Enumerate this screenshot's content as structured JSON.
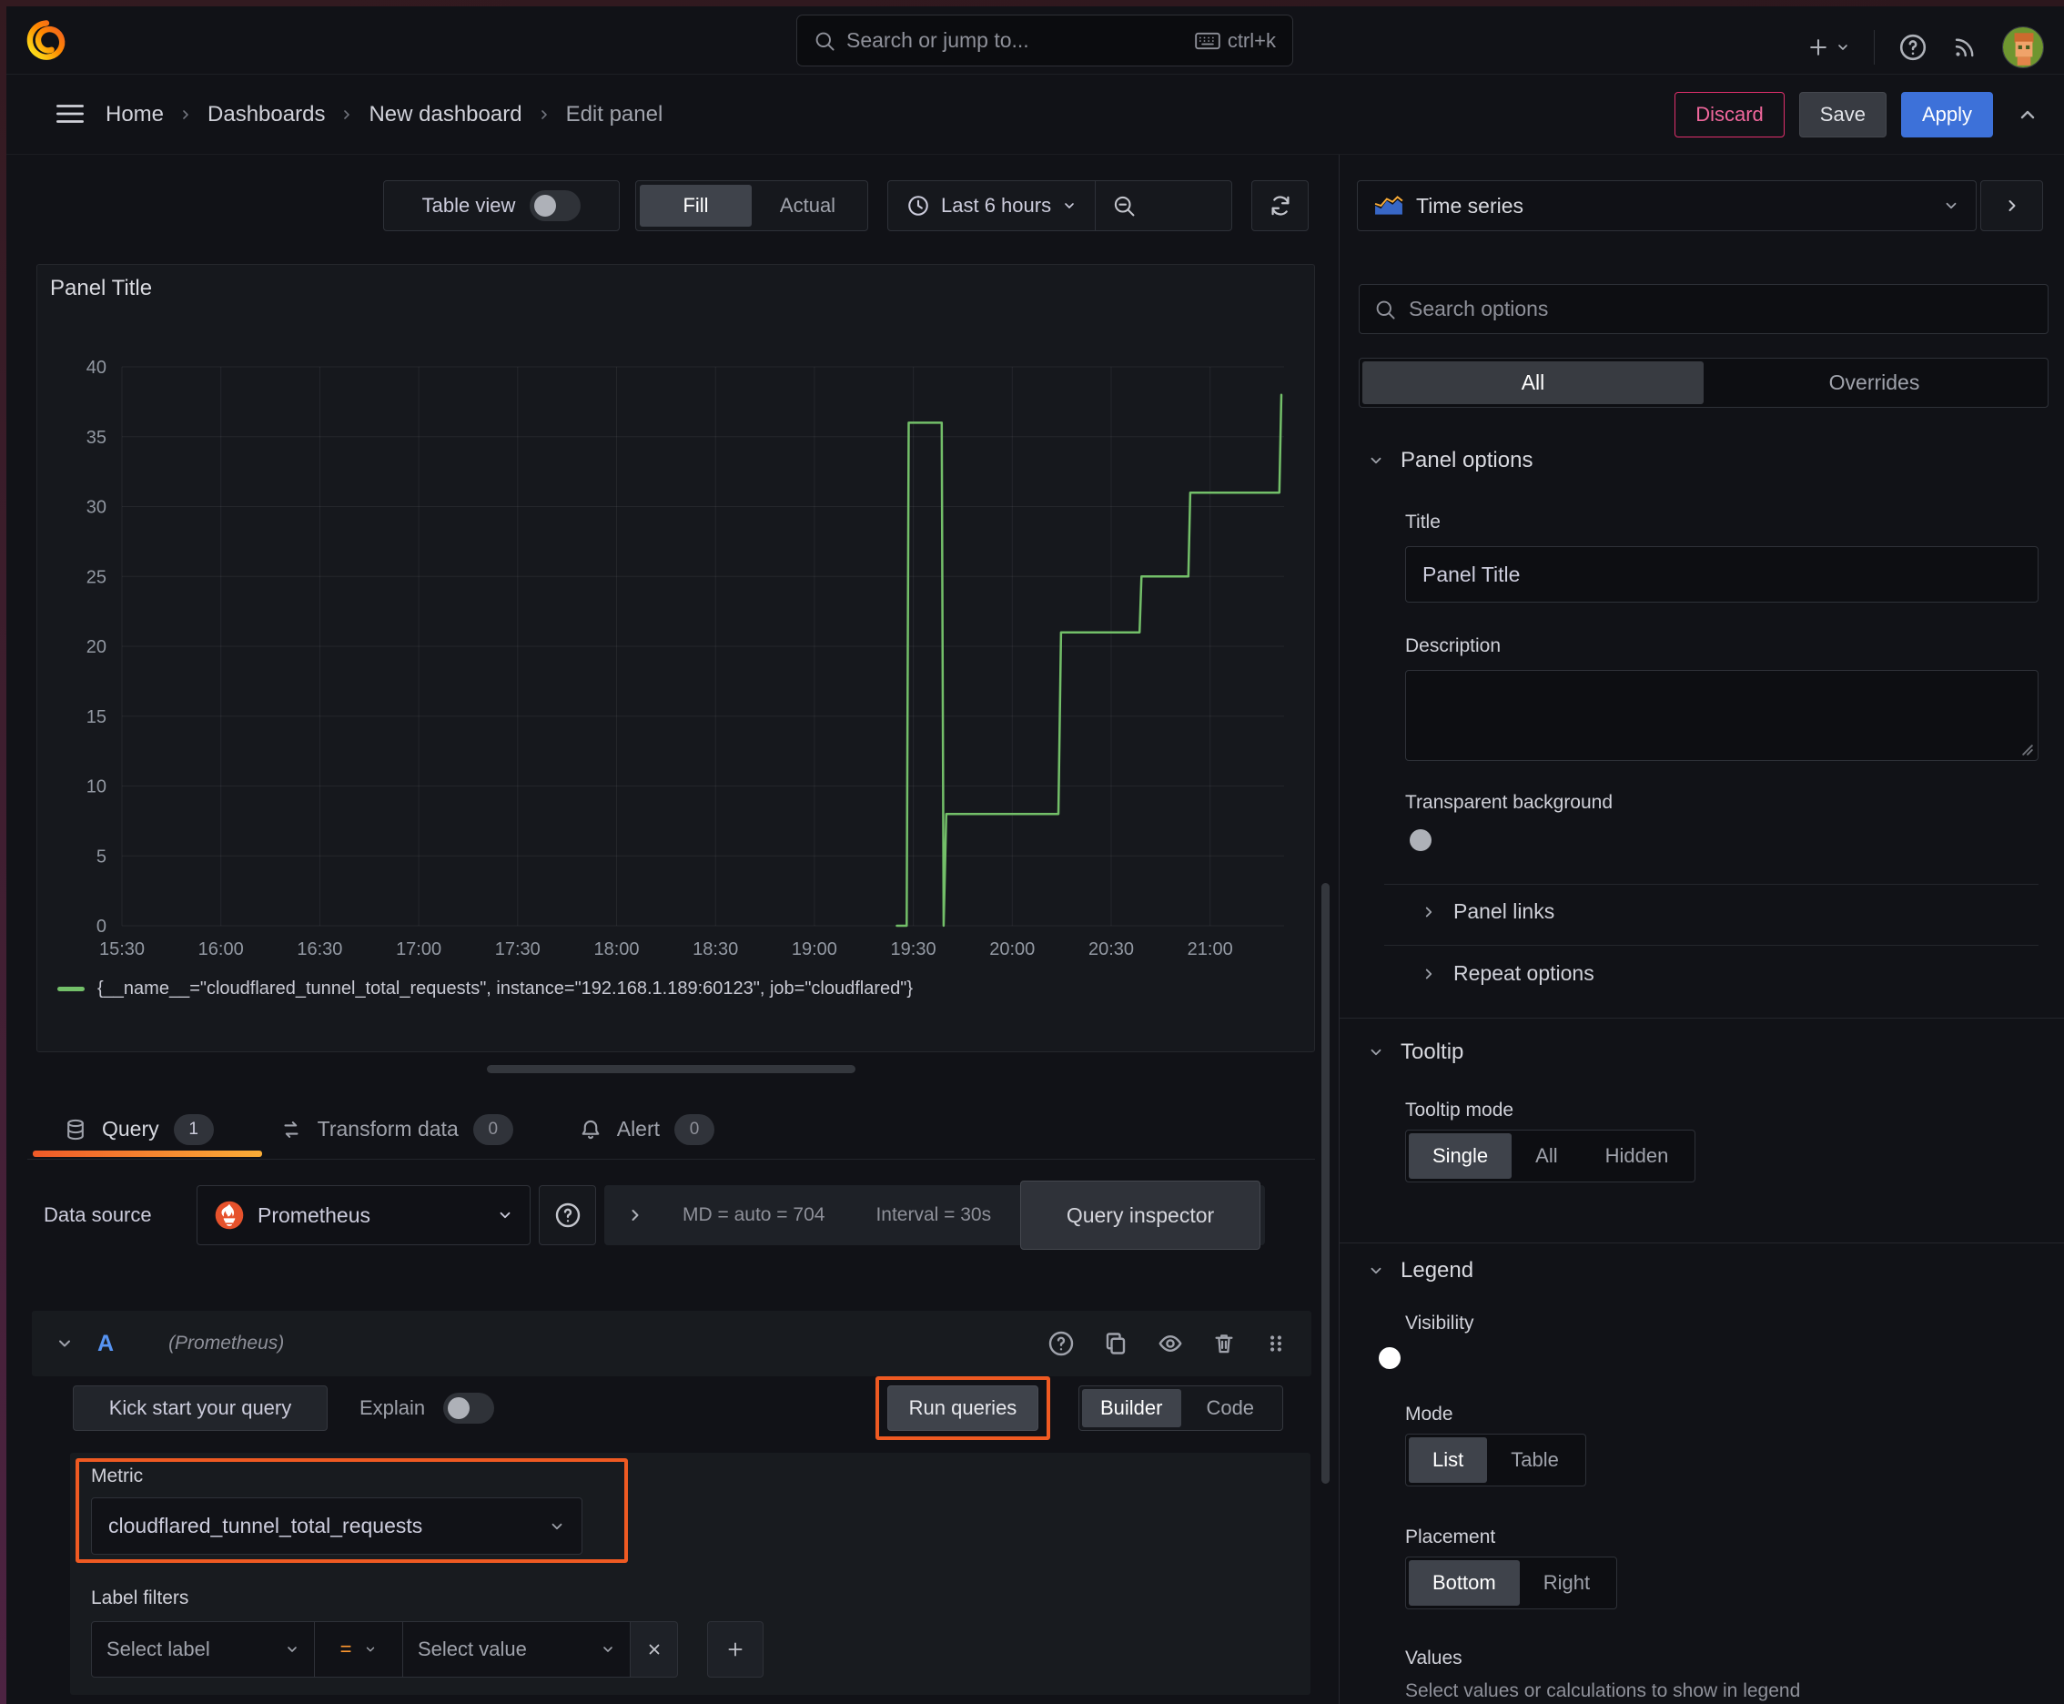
{
  "colors": {
    "accent_blue": "#3d71d9",
    "highlight_orange": "#ef5a22",
    "series_green": "#73bf69",
    "danger_pink": "#e02f6c",
    "tab_gradient_start": "#f05a28",
    "tab_gradient_end": "#fbad37"
  },
  "topnav": {
    "search_placeholder": "Search or jump to...",
    "shortcut": "ctrl+k"
  },
  "breadcrumb": {
    "items": [
      "Home",
      "Dashboards",
      "New dashboard",
      "Edit panel"
    ]
  },
  "actions": {
    "discard": "Discard",
    "save": "Save",
    "apply": "Apply"
  },
  "toolbar": {
    "table_view": "Table view",
    "fill": "Fill",
    "actual": "Actual",
    "time_range": "Last 6 hours"
  },
  "viz_picker": {
    "label": "Time series"
  },
  "panel": {
    "title": "Panel Title"
  },
  "chart_data": {
    "type": "line",
    "title": "Panel Title",
    "xlabel": "",
    "ylabel": "",
    "ylim": [
      0,
      40
    ],
    "grid": true,
    "legend_position": "bottom",
    "y_ticks": [
      0,
      5,
      10,
      15,
      20,
      25,
      30,
      35,
      40
    ],
    "x_ticks": [
      "15:30",
      "16:00",
      "16:30",
      "17:00",
      "17:30",
      "18:00",
      "18:30",
      "19:00",
      "19:30",
      "20:00",
      "20:30",
      "21:00"
    ],
    "x_tick_step_minutes": 30,
    "series": [
      {
        "name": "{__name__=\"cloudflared_tunnel_total_requests\", instance=\"192.168.1.189:60123\", job=\"cloudflared\"}",
        "color": "#73bf69",
        "points_minutes_value": [
          [
            235,
            0
          ],
          [
            238,
            0
          ],
          [
            238.6,
            36
          ],
          [
            248.6,
            36
          ],
          [
            249.2,
            0
          ],
          [
            250,
            8
          ],
          [
            284,
            8
          ],
          [
            284.8,
            21
          ],
          [
            308.6,
            21
          ],
          [
            309.2,
            25
          ],
          [
            323.4,
            25
          ],
          [
            324,
            31
          ],
          [
            351,
            31
          ],
          [
            351.6,
            38
          ]
        ]
      }
    ]
  },
  "tabs": {
    "query": "Query",
    "query_count": "1",
    "transform": "Transform data",
    "transform_count": "0",
    "alert": "Alert",
    "alert_count": "0"
  },
  "query_editor": {
    "datasource_label": "Data source",
    "datasource": "Prometheus",
    "stats_md": "MD = auto = 704",
    "stats_interval": "Interval = 30s",
    "query_inspector": "Query inspector",
    "ref_id": "A",
    "ds_hint": "(Prometheus)",
    "kick_start": "Kick start your query",
    "explain": "Explain",
    "run_queries": "Run queries",
    "builder": "Builder",
    "code": "Code",
    "metric_label": "Metric",
    "metric_value": "cloudflared_tunnel_total_requests",
    "label_filters_label": "Label filters",
    "select_label": "Select label",
    "operator": "=",
    "select_value": "Select value"
  },
  "sidebar": {
    "search_placeholder": "Search options",
    "tabs": {
      "all": "All",
      "overrides": "Overrides"
    },
    "panel_options": {
      "title": "Panel options",
      "title_label": "Title",
      "title_value": "Panel Title",
      "description_label": "Description",
      "transparent_label": "Transparent background"
    },
    "links_label": "Panel links",
    "repeat_label": "Repeat options",
    "tooltip": {
      "title": "Tooltip",
      "mode_label": "Tooltip mode",
      "options": [
        "Single",
        "All",
        "Hidden"
      ],
      "selected": "Single"
    },
    "legend": {
      "title": "Legend",
      "visibility_label": "Visibility",
      "mode_label": "Mode",
      "mode_options": [
        "List",
        "Table"
      ],
      "placement_label": "Placement",
      "placement_options": [
        "Bottom",
        "Right"
      ],
      "values_label": "Values",
      "values_hint": "Select values or calculations to show in legend"
    }
  }
}
